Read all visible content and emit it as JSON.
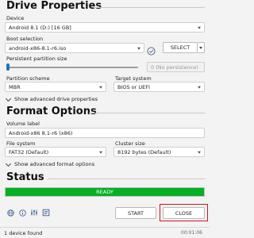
{
  "drive_properties": {
    "title": "Drive Properties",
    "device": {
      "label": "Device",
      "value": "Android 8.1 (D:) [16 GB]"
    },
    "boot_selection": {
      "label": "Boot selection",
      "value": "android-x86-8.1-r6.iso",
      "select_label": "SELECT"
    },
    "persistent": {
      "label": "Persistent partition size",
      "value": "0 (No persistence)",
      "slider_fraction": 0
    },
    "partition_scheme": {
      "label": "Partition scheme",
      "value": "MBR"
    },
    "target_system": {
      "label": "Target system",
      "value": "BIOS or UEFI"
    },
    "advanced_toggle": "Show advanced drive properties"
  },
  "format_options": {
    "title": "Format Options",
    "volume_label": {
      "label": "Volume label",
      "value": "Android-x86 8.1-r6 (x86)"
    },
    "file_system": {
      "label": "File system",
      "value": "FAT32 (Default)"
    },
    "cluster_size": {
      "label": "Cluster size",
      "value": "8192 bytes (Default)"
    },
    "advanced_toggle": "Show advanced format options"
  },
  "status": {
    "title": "Status",
    "progress_text": "READY",
    "progress_fraction": 1.0
  },
  "actions": {
    "start_label": "START",
    "close_label": "CLOSE"
  },
  "footer": {
    "devices_found": "1 device found",
    "timer": "00:01:06"
  },
  "colors": {
    "progress_green": "#06b025",
    "highlight_red": "#d3141c",
    "accent": "#1a73c8"
  },
  "icons": [
    "globe-icon",
    "info-icon",
    "settings-icon",
    "log-icon",
    "check-icon",
    "chevron-down-icon"
  ]
}
